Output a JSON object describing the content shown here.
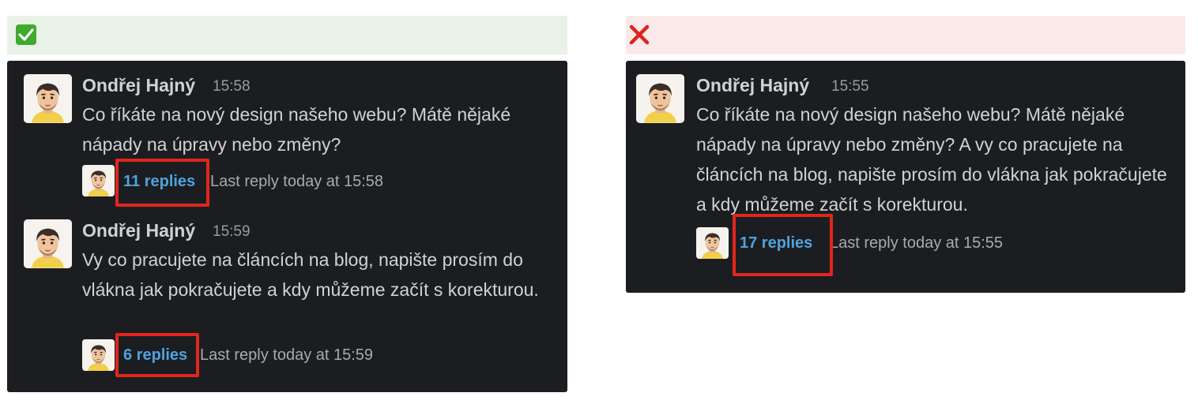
{
  "good_example": {
    "marker": "✅",
    "messages": [
      {
        "author": "Ondřej Hajný",
        "time": "15:58",
        "text": "Co říkáte na nový design našeho webu? Mátě nějaké nápady na úpravy nebo změny?",
        "replies": "11 replies",
        "last_reply": "Last reply today at 15:58"
      },
      {
        "author": "Ondřej Hajný",
        "time": "15:59",
        "text": "Vy co pracujete na článcích na blog, napište prosím do vlákna jak pokračujete a kdy můžeme začít s korekturou.",
        "replies": "6 replies",
        "last_reply": "Last reply today at 15:59"
      }
    ]
  },
  "bad_example": {
    "marker": "❌",
    "messages": [
      {
        "author": "Ondřej Hajný",
        "time": "15:55",
        "text": "Co říkáte na nový design našeho webu? Mátě nějaké nápady na úpravy nebo změny? A vy co pracujete na článcích na blog, napište prosím do vlákna jak pokračujete a kdy můžeme začít s korekturou.",
        "replies": "17 replies",
        "last_reply": "Last reply today at 15:55"
      }
    ]
  },
  "colors": {
    "panel_bg": "#1b1d21",
    "good_banner": "#e9f2e6",
    "bad_banner": "#fbe9ea",
    "link": "#4fa3dd",
    "highlight": "#e1261c"
  }
}
